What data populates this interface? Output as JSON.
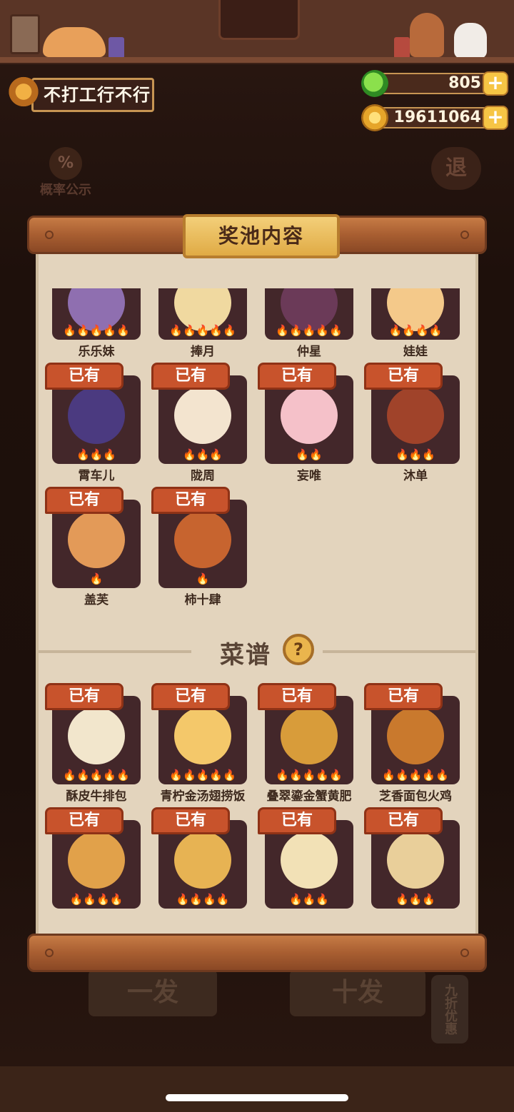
{
  "header": {
    "player_name": "不打工行不行",
    "gems": "805",
    "coins": "19611064",
    "plus_label": "+",
    "probability_label": "概率公示",
    "probability_icon": "%",
    "exit_label": "退"
  },
  "modal": {
    "title": "奖池内容",
    "owned_label": "已有",
    "characters": [
      {
        "name": "乐乐妹",
        "stars": "🔥🔥🔥🔥🔥",
        "owned": false
      },
      {
        "name": "捧月",
        "stars": "🔥🔥🔥🔥🔥",
        "owned": false
      },
      {
        "name": "仲星",
        "stars": "🔥🔥🔥🔥🔥",
        "owned": false
      },
      {
        "name": "娃娃",
        "stars": "🔥🔥🔥🔥",
        "owned": false
      },
      {
        "name": "霄车儿",
        "stars": "🔥🔥🔥",
        "owned": true
      },
      {
        "name": "陇周",
        "stars": "🔥🔥🔥",
        "owned": true
      },
      {
        "name": "妄唯",
        "stars": "🔥🔥",
        "owned": true
      },
      {
        "name": "沐单",
        "stars": "🔥🔥🔥",
        "owned": true
      },
      {
        "name": "盖芙",
        "stars": "🔥",
        "owned": true
      },
      {
        "name": "柿十肆",
        "stars": "🔥",
        "owned": true
      }
    ],
    "recipes_title": "菜谱",
    "help_icon": "?",
    "recipes": [
      {
        "name": "酥皮牛排包",
        "stars": "🔥🔥🔥🔥🔥",
        "owned": true
      },
      {
        "name": "青柠金汤翅捞饭",
        "stars": "🔥🔥🔥🔥🔥",
        "owned": true
      },
      {
        "name": "叠翠鎏金蟹黄肥",
        "stars": "🔥🔥🔥🔥🔥",
        "owned": true
      },
      {
        "name": "芝香面包火鸡",
        "stars": "🔥🔥🔥🔥🔥",
        "owned": true
      },
      {
        "name": "",
        "stars": "🔥🔥🔥🔥",
        "owned": true
      },
      {
        "name": "",
        "stars": "🔥🔥🔥🔥",
        "owned": true
      },
      {
        "name": "",
        "stars": "🔥🔥🔥",
        "owned": true
      },
      {
        "name": "",
        "stars": "🔥🔥🔥",
        "owned": true
      }
    ]
  },
  "bottom": {
    "single_draw": "一发",
    "ten_draw": "十发",
    "discount": "九折优惠"
  },
  "colors": {
    "accent_orange": "#c8532c",
    "plate_gold": "#e0ab45",
    "panel_bg": "#e3d4bd",
    "tile_bg": "#43272a"
  }
}
